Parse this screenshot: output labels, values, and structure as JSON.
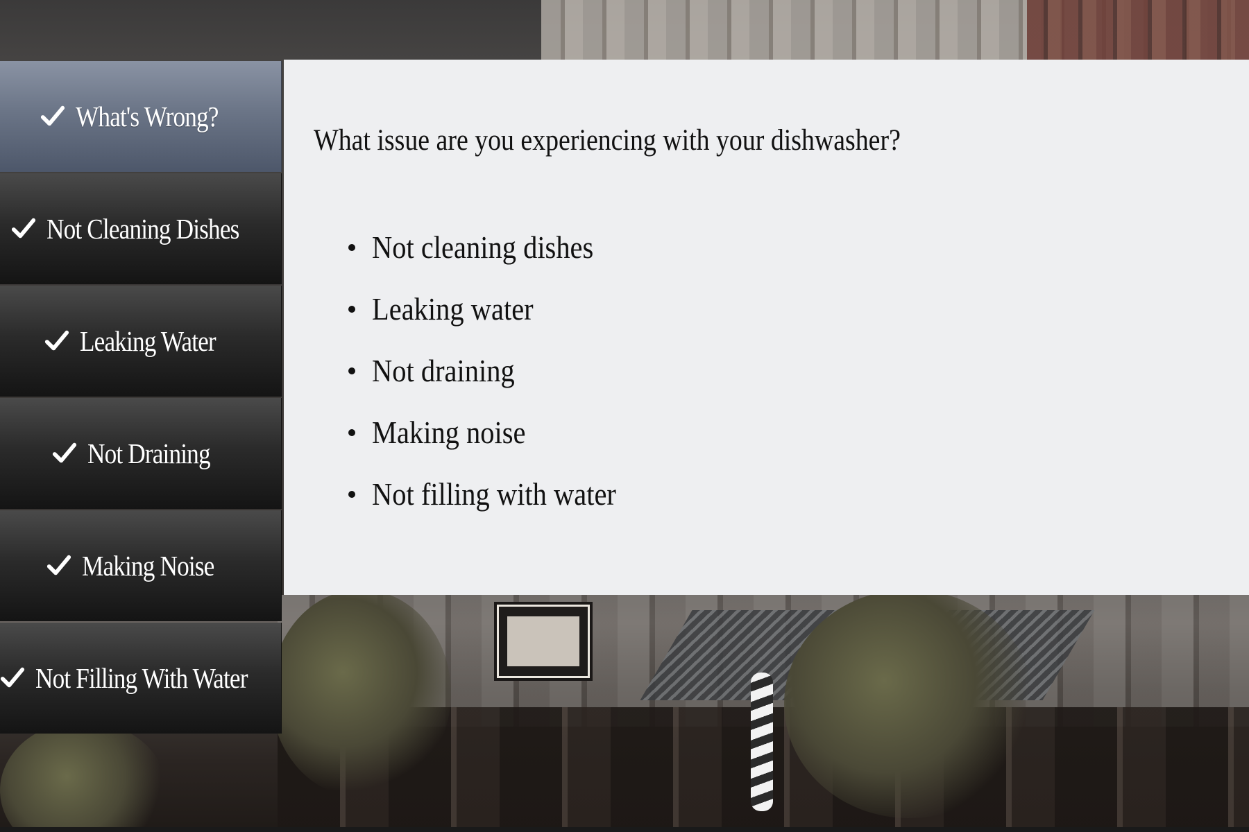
{
  "sidebar": {
    "items": [
      {
        "label": "What's Wrong?",
        "icon": "checkmark-icon",
        "active": true
      },
      {
        "label": "Not Cleaning Dishes",
        "icon": "checkmark-icon",
        "active": false
      },
      {
        "label": "Leaking Water",
        "icon": "checkmark-icon",
        "active": false
      },
      {
        "label": "Not Draining",
        "icon": "checkmark-icon",
        "active": false
      },
      {
        "label": "Making Noise",
        "icon": "checkmark-icon",
        "active": false
      },
      {
        "label": "Not Filling With Water",
        "icon": "checkmark-icon",
        "active": false
      }
    ]
  },
  "content": {
    "question": "What issue are you experiencing with your dishwasher?",
    "options": [
      "Not cleaning dishes",
      "Leaking water",
      "Not draining",
      "Making noise",
      "Not filling with water"
    ]
  },
  "colors": {
    "active_tab": "#6b7587",
    "inactive_tab": "#2b2b2b",
    "panel_background": "#eeeff1",
    "text_dark": "#111111",
    "text_light": "#ffffff"
  }
}
